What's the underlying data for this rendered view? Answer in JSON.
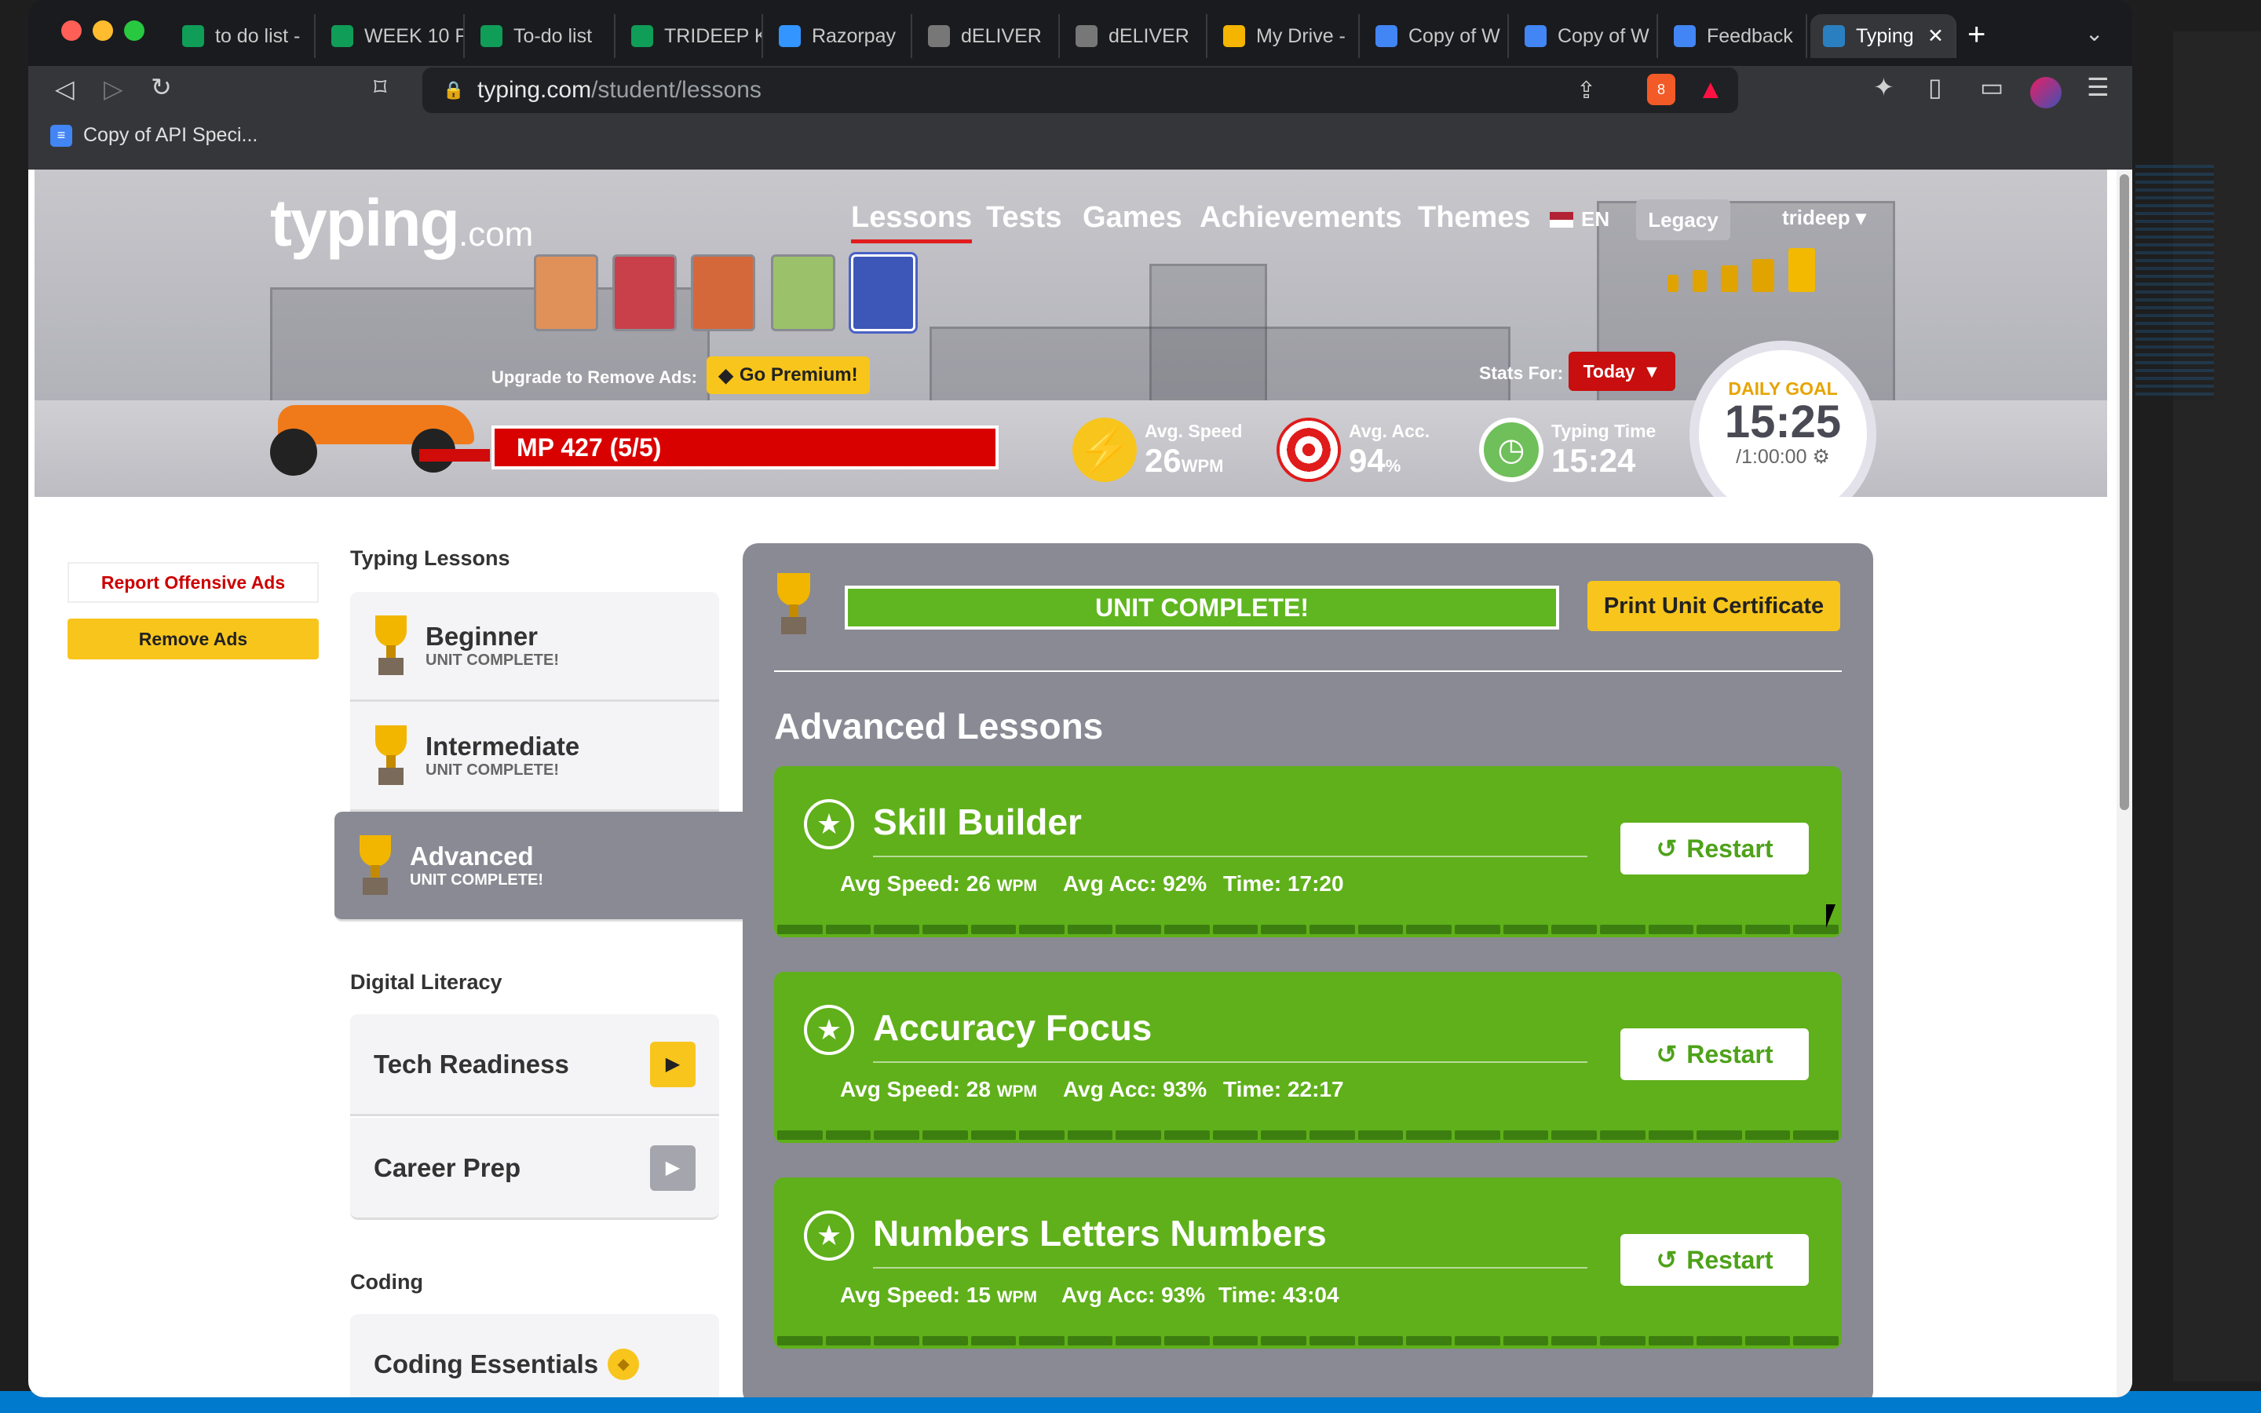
{
  "browser": {
    "tabs": [
      {
        "label": "to do list -",
        "icon": "sheets-icon",
        "color": "#0f9d58"
      },
      {
        "label": "WEEK 10 F",
        "icon": "sheets-icon",
        "color": "#0f9d58"
      },
      {
        "label": "To-do list",
        "icon": "sheets-icon",
        "color": "#0f9d58"
      },
      {
        "label": "TRIDEEP K",
        "icon": "sheets-icon",
        "color": "#0f9d58"
      },
      {
        "label": "Razorpay",
        "icon": "razorpay-icon",
        "color": "#3395ff"
      },
      {
        "label": "dELIVER",
        "icon": "globe-icon",
        "color": "#777777"
      },
      {
        "label": "dELIVER",
        "icon": "globe-icon",
        "color": "#777777"
      },
      {
        "label": "My Drive -",
        "icon": "drive-icon",
        "color": "#f4b400"
      },
      {
        "label": "Copy of W",
        "icon": "docs-icon",
        "color": "#4285f4"
      },
      {
        "label": "Copy of W",
        "icon": "docs-icon",
        "color": "#4285f4"
      },
      {
        "label": "Feedback",
        "icon": "docs-icon",
        "color": "#4285f4"
      },
      {
        "label": "Typing",
        "icon": "typing-icon",
        "color": "#2a7fc1"
      }
    ],
    "url_host": "typing.com",
    "url_path": "/student/lessons",
    "bookmark": "Copy of API Speci...",
    "brave_badge": "8",
    "alert_badge": "1"
  },
  "site": {
    "logo_main": "typing",
    "logo_dom": ".com",
    "nav": [
      "Lessons",
      "Tests",
      "Games",
      "Achievements",
      "Themes"
    ],
    "language": "EN",
    "legacy": "Legacy",
    "user": "trideep",
    "upgrade_text": "Upgrade to Remove Ads:",
    "premium_label": "Go Premium!",
    "mp": "MP 427 (5/5)",
    "stats_for": "Stats For:",
    "stats_range": "Today",
    "avg_speed_label": "Avg. Speed",
    "avg_speed_value": "26",
    "avg_speed_unit": "WPM",
    "avg_acc_label": "Avg. Acc.",
    "avg_acc_value": "94",
    "avg_acc_unit": "%",
    "typing_time_label": "Typing Time",
    "typing_time_value": "15:24",
    "daily_goal_label": "DAILY GOAL",
    "daily_goal_value": "15:25",
    "daily_goal_target": "/1:00:00"
  },
  "sidebar": {
    "report_ads": "Report Offensive Ads",
    "remove_ads": "Remove Ads",
    "typing_lessons_title": "Typing Lessons",
    "typing_lessons": [
      {
        "name": "Beginner",
        "status": "UNIT COMPLETE!"
      },
      {
        "name": "Intermediate",
        "status": "UNIT COMPLETE!"
      },
      {
        "name": "Advanced",
        "status": "UNIT COMPLETE!"
      }
    ],
    "digital_literacy_title": "Digital Literacy",
    "digital_literacy": [
      "Tech Readiness",
      "Career Prep"
    ],
    "coding_title": "Coding",
    "coding": [
      "Coding Essentials"
    ]
  },
  "main": {
    "unit_complete": "UNIT COMPLETE!",
    "print_certificate": "Print Unit Certificate",
    "section_title": "Advanced Lessons",
    "restart_label": "Restart",
    "lessons": [
      {
        "name": "Skill Builder",
        "speed": "Avg Speed: 26",
        "unit": "WPM",
        "acc": "Avg Acc: 92%",
        "time": "Time: 17:20"
      },
      {
        "name": "Accuracy Focus",
        "speed": "Avg Speed: 28",
        "unit": "WPM",
        "acc": "Avg Acc: 93%",
        "time": "Time: 22:17"
      },
      {
        "name": "Numbers Letters Numbers",
        "speed": "Avg Speed: 15",
        "unit": "WPM",
        "acc": "Avg Acc: 93%",
        "time": "Time: 43:04"
      }
    ]
  }
}
